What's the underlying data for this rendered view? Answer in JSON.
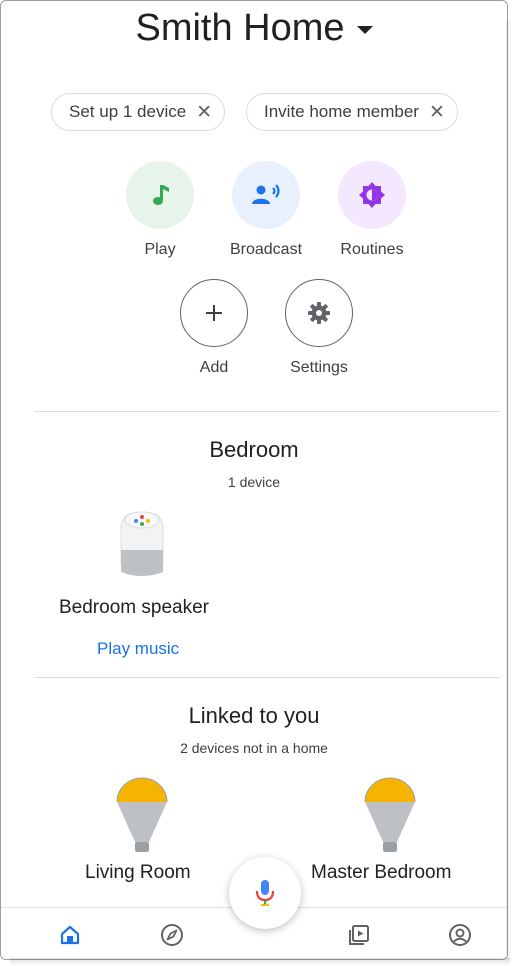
{
  "header": {
    "home_name": "Smith Home"
  },
  "chips": [
    {
      "label": "Set up 1 device"
    },
    {
      "label": "Invite home member"
    }
  ],
  "chip_close_glyph": "✕",
  "actions": [
    {
      "label": "Play",
      "icon": "music-note-icon",
      "bg": "#e6f4ea",
      "color": "#34a853"
    },
    {
      "label": "Broadcast",
      "icon": "broadcast-icon",
      "bg": "#e8f0fe",
      "color": "#1a73e8"
    },
    {
      "label": "Routines",
      "icon": "routines-icon",
      "bg": "#f3e8fd",
      "color": "#9334e6"
    },
    {
      "label": "Add",
      "icon": "plus-icon"
    },
    {
      "label": "Settings",
      "icon": "gear-icon"
    }
  ],
  "bedroom": {
    "title": "Bedroom",
    "subtitle": "1 device",
    "device_name": "Bedroom speaker",
    "action_link": "Play music"
  },
  "linked": {
    "title": "Linked to you",
    "subtitle": "2 devices not in a home",
    "devices": [
      {
        "name": "Living Room",
        "icon": "light-bulb-icon"
      },
      {
        "name": "Master Bedroom",
        "icon": "light-bulb-icon"
      }
    ]
  },
  "nav": [
    {
      "icon": "home-icon",
      "active": true
    },
    {
      "icon": "compass-icon",
      "active": false
    },
    {
      "icon": "media-icon",
      "active": false
    },
    {
      "icon": "account-icon",
      "active": false
    }
  ],
  "colors": {
    "accent": "#1a73e8",
    "bulb": "#f4b400"
  }
}
